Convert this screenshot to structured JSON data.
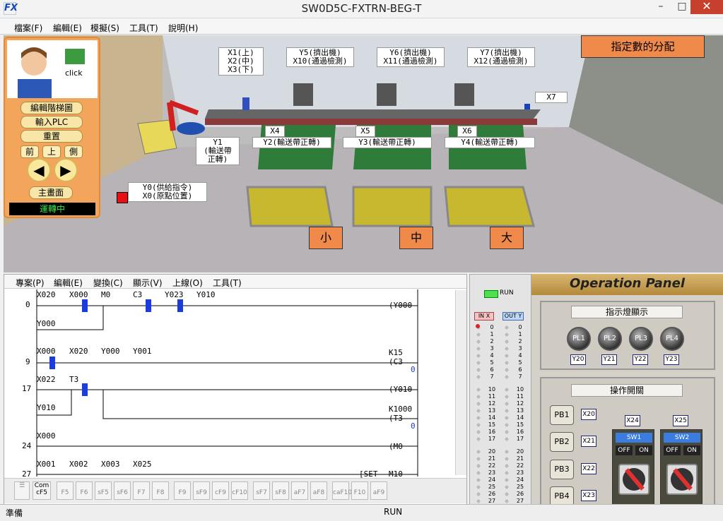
{
  "window": {
    "title": "SW0D5C-FXTRN-BEG-T",
    "icon_text": "FX"
  },
  "menubar": [
    "檔案(F)",
    "編輯(E)",
    "模擬(S)",
    "工具(T)",
    "說明(H)"
  ],
  "left_panel": {
    "click_text": "click",
    "buttons": [
      "編輯階梯圖",
      "輸入PLC",
      "重置"
    ],
    "views": [
      "前",
      "上",
      "側"
    ],
    "home": "主畫面",
    "status": "運轉中"
  },
  "scene": {
    "title": "指定數的分配",
    "labels": {
      "x1": "X1(上)\nX2(中)\nX3(下)",
      "y5": "Y5(擠出機)\nX10(通過檢測)",
      "y6": "Y6(擠出機)\nX11(通過檢測)",
      "y7": "Y7(擠出機)\nX12(通過檢測)",
      "x7": "X7",
      "x4": "X4",
      "x5": "X5",
      "x6": "X6",
      "y2": "Y2(輸送帶正轉)",
      "y3": "Y3(輸送帶正轉)",
      "y4": "Y4(輸送帶正轉)",
      "y1": "Y1\n(輸送帶\n正轉)",
      "y0": "Y0(供給指令)\nX0(原點位置)"
    },
    "sizes": [
      "小",
      "中",
      "大"
    ]
  },
  "ladder_menu": [
    "專案(P)",
    "編輯(E)",
    "變換(C)",
    "顯示(V)",
    "上線(O)",
    "工具(T)"
  ],
  "ladder": {
    "steps": [
      "0",
      "9",
      "17",
      "24",
      "27"
    ],
    "contacts": [
      "X020",
      "X000",
      "M0",
      "C3",
      "Y023",
      "Y010",
      "Y000",
      "X000",
      "X020",
      "Y000",
      "Y001",
      "X022",
      "T3",
      "Y010",
      "X000",
      "X001",
      "X002",
      "X003",
      "X025"
    ],
    "coils": [
      "(Y000",
      "K15",
      "(C3",
      "(Y010",
      "K1000",
      "(T3",
      "(M0",
      "[SET",
      "M10"
    ],
    "values": [
      "0",
      "0"
    ]
  },
  "toolbar": [
    "Com\ncF5",
    "F5",
    "F6",
    "sF5",
    "sF6",
    "F7",
    "F8",
    "F9",
    "sF9",
    "cF9",
    "cF10",
    "sF7",
    "sF8",
    "aF7",
    "aF8",
    "caF10",
    "F10",
    "aF9"
  ],
  "io_panel": {
    "run": "RUN",
    "in_head": "IN X",
    "out_head": "OUT Y",
    "nums_a": [
      "0",
      "1",
      "2",
      "3",
      "4",
      "5",
      "6",
      "7"
    ],
    "nums_b": [
      "10",
      "11",
      "12",
      "13",
      "14",
      "15",
      "16",
      "17"
    ],
    "nums_c": [
      "20",
      "21",
      "22",
      "23",
      "24",
      "25",
      "26",
      "27"
    ]
  },
  "op_panel": {
    "title": "Operation Panel",
    "indicator_title": "指示燈顯示",
    "lamps": [
      "PL1",
      "PL2",
      "PL3",
      "PL4"
    ],
    "lamp_addr": [
      "Y20",
      "Y21",
      "Y22",
      "Y23"
    ],
    "switch_title": "操作開關",
    "pbs": [
      "PB1",
      "PB2",
      "PB3",
      "PB4"
    ],
    "pb_addr": [
      "X20",
      "X21",
      "X22",
      "X23"
    ],
    "sw_addr": [
      "X24",
      "X25"
    ],
    "sws": [
      "SW1",
      "SW2"
    ],
    "off": "OFF",
    "on": "ON"
  },
  "status": {
    "left": "準備",
    "mid": "RUN"
  }
}
